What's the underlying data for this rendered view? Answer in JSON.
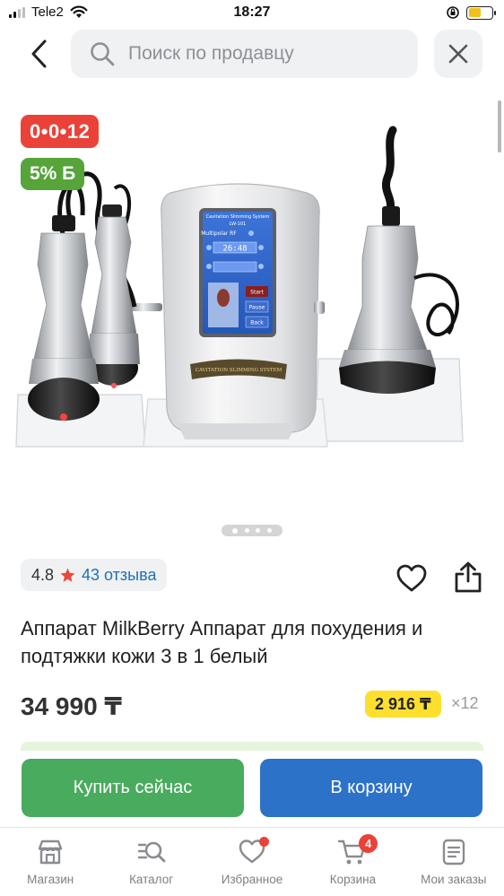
{
  "status_bar": {
    "carrier": "Tele2",
    "time": "18:27"
  },
  "search": {
    "placeholder": "Поиск по продавцу"
  },
  "product": {
    "timer_badge": "0•0•12",
    "bonus_badge": "5% Б",
    "image_count": 4,
    "active_image": 1,
    "rating_value": "4.8",
    "reviews_label": "43 отзыва",
    "title": "Аппарат MilkBerry Аппарат для похудения и подтяжки кожи 3 в 1 белый",
    "price": "34 990 ₸",
    "installment_price": "2 916 ₸",
    "installment_months": "×12",
    "device_screen": {
      "header": "Cavitation Slimming System",
      "model": "LW-101",
      "mode": "Multipolar RF",
      "timer": "26:48",
      "start": "Start",
      "pause": "Pause",
      "back": "Back",
      "plate": "CAVITATION SLIMMING SYSTEM"
    }
  },
  "actions": {
    "buy_now": "Купить сейчас",
    "add_to_cart": "В корзину"
  },
  "tab_bar": {
    "tabs": [
      {
        "label": "Магазин",
        "icon": "store-icon"
      },
      {
        "label": "Каталог",
        "icon": "catalog-search-icon"
      },
      {
        "label": "Избранное",
        "icon": "heart-icon"
      },
      {
        "label": "Корзина",
        "icon": "cart-icon"
      },
      {
        "label": "Мои заказы",
        "icon": "orders-icon"
      }
    ],
    "cart_count": "4"
  },
  "colors": {
    "timer_badge": "#ea4238",
    "bonus_badge": "#56a43a",
    "buy_button": "#49ab5e",
    "cart_button": "#2c72c8",
    "installment_badge": "#ffdf2e",
    "link": "#1f6fb8"
  }
}
